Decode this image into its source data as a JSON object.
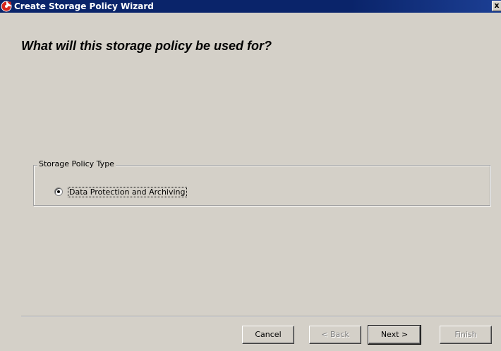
{
  "window": {
    "title": "Create Storage Policy Wizard",
    "close_label": "x"
  },
  "main": {
    "heading": "What will this storage policy be used for?",
    "group": {
      "legend": "Storage Policy Type",
      "options": [
        {
          "label": "Data Protection and Archiving",
          "selected": true
        }
      ]
    }
  },
  "footer": {
    "cancel_label": "Cancel",
    "back_label": "< Back",
    "next_label": "Next >",
    "finish_label": "Finish"
  },
  "colors": {
    "titlebar": "#0a246a",
    "dialog_bg": "#d4d0c8",
    "icon_red": "#d9261c"
  }
}
